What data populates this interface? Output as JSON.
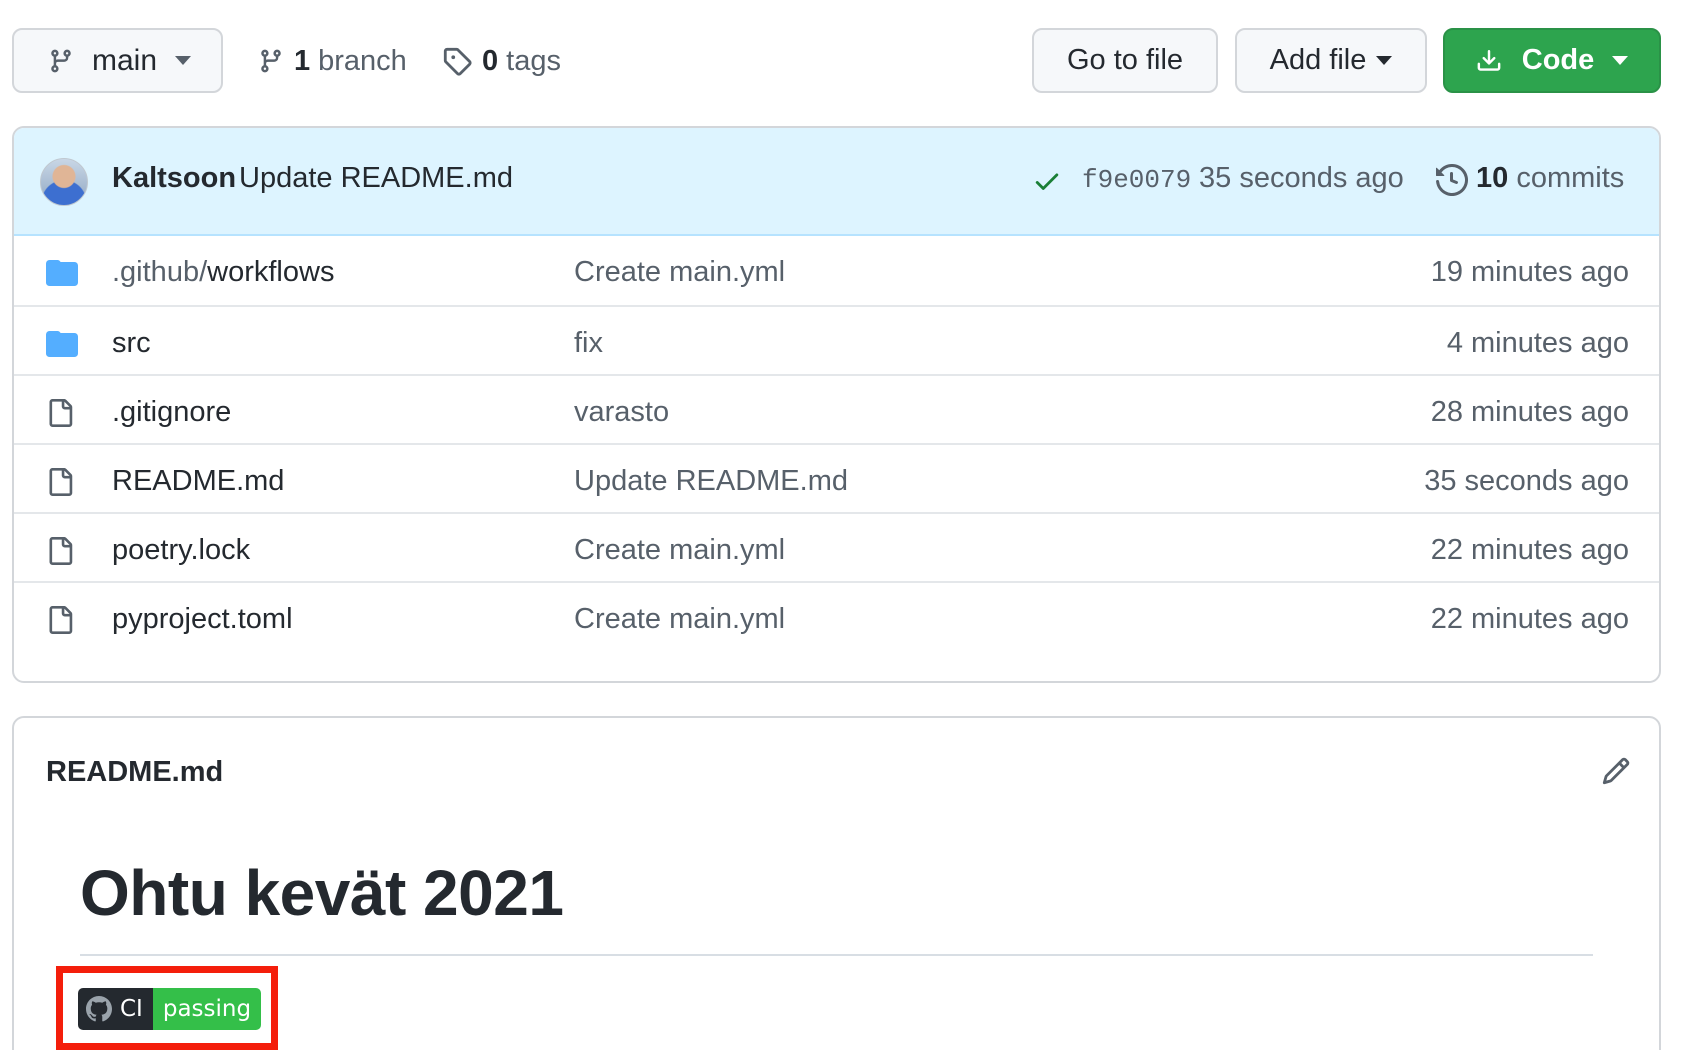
{
  "toolbar": {
    "branch_name": "main",
    "branch_count": "1",
    "branch_label": "branch",
    "tag_count": "0",
    "tag_label": "tags",
    "goto_file_label": "Go to file",
    "add_file_label": "Add file",
    "code_label": "Code"
  },
  "latest_commit": {
    "author": "Kaltsoon",
    "message": "Update README.md",
    "status": "check-icon",
    "sha": "f9e0079",
    "time": "35 seconds ago",
    "commit_count": "10",
    "commit_label": "commits"
  },
  "files": [
    {
      "type": "folder",
      "name_prefix": ".github/",
      "name": "workflows",
      "message": "Create main.yml",
      "age": "19 minutes ago"
    },
    {
      "type": "folder",
      "name_prefix": "",
      "name": "src",
      "message": "fix",
      "age": "4 minutes ago"
    },
    {
      "type": "file",
      "name_prefix": "",
      "name": ".gitignore",
      "message": "varasto",
      "age": "28 minutes ago"
    },
    {
      "type": "file",
      "name_prefix": "",
      "name": "README.md",
      "message": "Update README.md",
      "age": "35 seconds ago"
    },
    {
      "type": "file",
      "name_prefix": "",
      "name": "poetry.lock",
      "message": "Create main.yml",
      "age": "22 minutes ago"
    },
    {
      "type": "file",
      "name_prefix": "",
      "name": "pyproject.toml",
      "message": "Create main.yml",
      "age": "22 minutes ago"
    }
  ],
  "readme": {
    "filename": "README.md",
    "heading": "Ohtu kevät 2021",
    "badge_left": "CI",
    "badge_right": "passing"
  },
  "colors": {
    "primary_button": "#2da44e",
    "commit_bar": "#ddf4ff",
    "folder_icon": "#54aeff",
    "highlight": "#f41e0b",
    "badge_pass": "#34bf49"
  }
}
